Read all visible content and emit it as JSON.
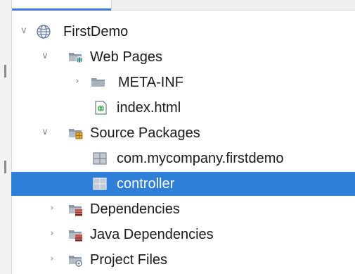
{
  "tree": {
    "items": [
      {
        "label": "FirstDemo",
        "chevron": "chevron-down",
        "icon": "globe-project-icon"
      },
      {
        "label": "Web Pages",
        "chevron": "chevron-down",
        "icon": "web-pages-folder-icon"
      },
      {
        "label": "META-INF",
        "chevron": "chevron-right",
        "icon": "folder-icon"
      },
      {
        "label": "index.html",
        "chevron": "",
        "icon": "html-file-icon"
      },
      {
        "label": "Source Packages",
        "chevron": "chevron-down",
        "icon": "source-packages-folder-icon"
      },
      {
        "label": "com.mycompany.firstdemo",
        "chevron": "",
        "icon": "package-icon"
      },
      {
        "label": "controller",
        "chevron": "",
        "icon": "package-icon",
        "selected": true
      },
      {
        "label": "Dependencies",
        "chevron": "chevron-right",
        "icon": "dependencies-folder-icon"
      },
      {
        "label": "Java Dependencies",
        "chevron": "chevron-right",
        "icon": "java-dependencies-folder-icon"
      },
      {
        "label": "Project Files",
        "chevron": "chevron-right",
        "icon": "project-files-folder-icon"
      }
    ]
  },
  "colors": {
    "selection": "#2f7ed8",
    "tab_accent": "#3c78d8"
  }
}
